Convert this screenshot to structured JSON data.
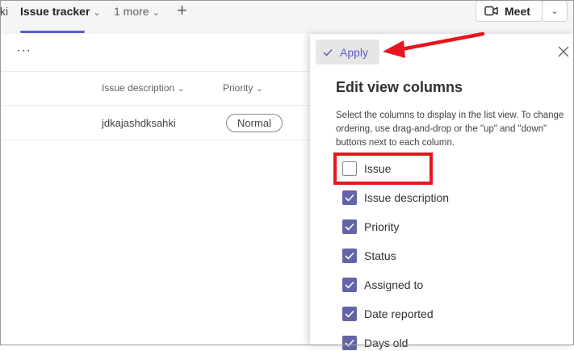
{
  "tabs": {
    "prev_fragment": "ki",
    "active": "Issue tracker",
    "more": "1 more"
  },
  "meet": {
    "label": "Meet"
  },
  "list": {
    "columns": [
      "Issue description",
      "Priority"
    ],
    "rows": [
      {
        "description": "jdkajashdksahki",
        "priority": "Normal"
      }
    ]
  },
  "panel": {
    "apply_label": "Apply",
    "title": "Edit view columns",
    "description": "Select the columns to display in the list view. To change ordering, use drag-and-drop or the \"up\" and \"down\" buttons next to each column.",
    "columns": [
      {
        "label": "Issue",
        "checked": false
      },
      {
        "label": "Issue description",
        "checked": true
      },
      {
        "label": "Priority",
        "checked": true
      },
      {
        "label": "Status",
        "checked": true
      },
      {
        "label": "Assigned to",
        "checked": true
      },
      {
        "label": "Date reported",
        "checked": true
      },
      {
        "label": "Days old",
        "checked": true
      }
    ]
  },
  "colors": {
    "accent": "#5b5fc7",
    "checkbox": "#6264a7",
    "annotation": "#e8141e"
  }
}
